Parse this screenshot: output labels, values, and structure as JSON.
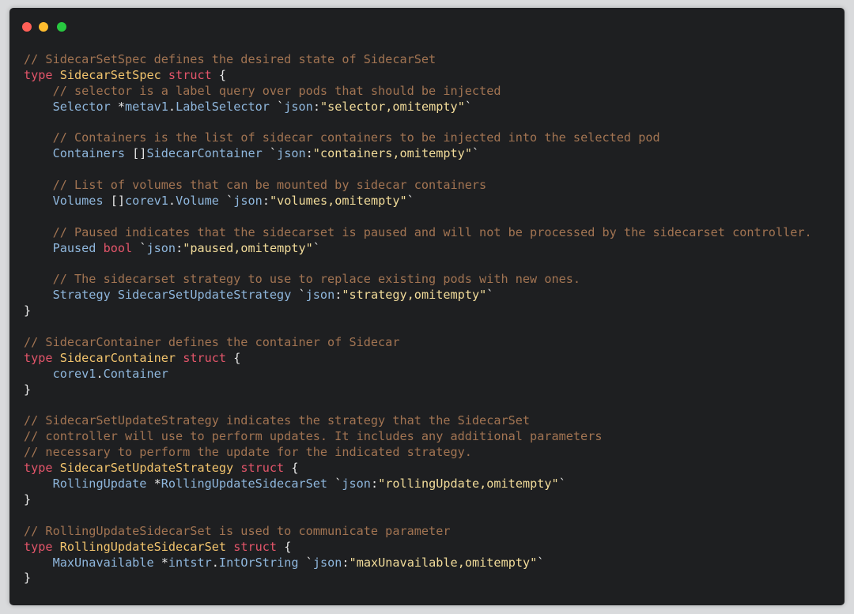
{
  "window": {
    "controls": {
      "close_color": "#ff5f57",
      "minimize_color": "#febc2e",
      "maximize_color": "#28c840"
    }
  },
  "colors": {
    "background": "#1e1f21",
    "comment": "#a27452",
    "keyword": "#e3556a",
    "type_name": "#f2c46d",
    "field": "#8fb7dd",
    "string": "#f2dc9a"
  },
  "code_lines": [
    [
      [
        "// SidecarSetSpec defines the desired state of SidecarSet",
        "comment"
      ]
    ],
    [
      [
        "type",
        "keyword"
      ],
      [
        " ",
        "plain"
      ],
      [
        "SidecarSetSpec",
        "typename"
      ],
      [
        " ",
        "plain"
      ],
      [
        "struct",
        "keyword"
      ],
      [
        " {",
        "plain"
      ]
    ],
    [
      [
        "    ",
        "plain"
      ],
      [
        "// selector is a label query over pods that should be injected",
        "comment"
      ]
    ],
    [
      [
        "    ",
        "plain"
      ],
      [
        "Selector",
        "field"
      ],
      [
        " *",
        "plain"
      ],
      [
        "metav1",
        "type"
      ],
      [
        ".",
        "plain"
      ],
      [
        "LabelSelector",
        "type"
      ],
      [
        " `",
        "plain"
      ],
      [
        "json",
        "tag"
      ],
      [
        ":",
        "plain"
      ],
      [
        "\"selector,omitempty\"",
        "string"
      ],
      [
        "`",
        "plain"
      ]
    ],
    [],
    [
      [
        "    ",
        "plain"
      ],
      [
        "// Containers is the list of sidecar containers to be injected into the selected pod",
        "comment"
      ]
    ],
    [
      [
        "    ",
        "plain"
      ],
      [
        "Containers",
        "field"
      ],
      [
        " []",
        "plain"
      ],
      [
        "SidecarContainer",
        "type"
      ],
      [
        " `",
        "plain"
      ],
      [
        "json",
        "tag"
      ],
      [
        ":",
        "plain"
      ],
      [
        "\"containers,omitempty\"",
        "string"
      ],
      [
        "`",
        "plain"
      ]
    ],
    [],
    [
      [
        "    ",
        "plain"
      ],
      [
        "// List of volumes that can be mounted by sidecar containers",
        "comment"
      ]
    ],
    [
      [
        "    ",
        "plain"
      ],
      [
        "Volumes",
        "field"
      ],
      [
        " []",
        "plain"
      ],
      [
        "corev1",
        "type"
      ],
      [
        ".",
        "plain"
      ],
      [
        "Volume",
        "type"
      ],
      [
        " `",
        "plain"
      ],
      [
        "json",
        "tag"
      ],
      [
        ":",
        "plain"
      ],
      [
        "\"volumes,omitempty\"",
        "string"
      ],
      [
        "`",
        "plain"
      ]
    ],
    [],
    [
      [
        "    ",
        "plain"
      ],
      [
        "// Paused indicates that the sidecarset is paused and will not be processed by the sidecarset controller.",
        "comment"
      ]
    ],
    [
      [
        "    ",
        "plain"
      ],
      [
        "Paused",
        "field"
      ],
      [
        " ",
        "plain"
      ],
      [
        "bool",
        "keyword"
      ],
      [
        " `",
        "plain"
      ],
      [
        "json",
        "tag"
      ],
      [
        ":",
        "plain"
      ],
      [
        "\"paused,omitempty\"",
        "string"
      ],
      [
        "`",
        "plain"
      ]
    ],
    [],
    [
      [
        "    ",
        "plain"
      ],
      [
        "// The sidecarset strategy to use to replace existing pods with new ones.",
        "comment"
      ]
    ],
    [
      [
        "    ",
        "plain"
      ],
      [
        "Strategy",
        "field"
      ],
      [
        " ",
        "plain"
      ],
      [
        "SidecarSetUpdateStrategy",
        "type"
      ],
      [
        " `",
        "plain"
      ],
      [
        "json",
        "tag"
      ],
      [
        ":",
        "plain"
      ],
      [
        "\"strategy,omitempty\"",
        "string"
      ],
      [
        "`",
        "plain"
      ]
    ],
    [
      [
        "}",
        "plain"
      ]
    ],
    [],
    [
      [
        "// SidecarContainer defines the container of Sidecar",
        "comment"
      ]
    ],
    [
      [
        "type",
        "keyword"
      ],
      [
        " ",
        "plain"
      ],
      [
        "SidecarContainer",
        "typename"
      ],
      [
        " ",
        "plain"
      ],
      [
        "struct",
        "keyword"
      ],
      [
        " {",
        "plain"
      ]
    ],
    [
      [
        "    ",
        "plain"
      ],
      [
        "corev1",
        "type"
      ],
      [
        ".",
        "plain"
      ],
      [
        "Container",
        "type"
      ]
    ],
    [
      [
        "}",
        "plain"
      ]
    ],
    [],
    [
      [
        "// SidecarSetUpdateStrategy indicates the strategy that the SidecarSet",
        "comment"
      ]
    ],
    [
      [
        "// controller will use to perform updates. It includes any additional parameters",
        "comment"
      ]
    ],
    [
      [
        "// necessary to perform the update for the indicated strategy.",
        "comment"
      ]
    ],
    [
      [
        "type",
        "keyword"
      ],
      [
        " ",
        "plain"
      ],
      [
        "SidecarSetUpdateStrategy",
        "typename"
      ],
      [
        " ",
        "plain"
      ],
      [
        "struct",
        "keyword"
      ],
      [
        " {",
        "plain"
      ]
    ],
    [
      [
        "    ",
        "plain"
      ],
      [
        "RollingUpdate",
        "field"
      ],
      [
        " *",
        "plain"
      ],
      [
        "RollingUpdateSidecarSet",
        "type"
      ],
      [
        " `",
        "plain"
      ],
      [
        "json",
        "tag"
      ],
      [
        ":",
        "plain"
      ],
      [
        "\"rollingUpdate,omitempty\"",
        "string"
      ],
      [
        "`",
        "plain"
      ]
    ],
    [
      [
        "}",
        "plain"
      ]
    ],
    [],
    [
      [
        "// RollingUpdateSidecarSet is used to communicate parameter",
        "comment"
      ]
    ],
    [
      [
        "type",
        "keyword"
      ],
      [
        " ",
        "plain"
      ],
      [
        "RollingUpdateSidecarSet",
        "typename"
      ],
      [
        " ",
        "plain"
      ],
      [
        "struct",
        "keyword"
      ],
      [
        " {",
        "plain"
      ]
    ],
    [
      [
        "    ",
        "plain"
      ],
      [
        "MaxUnavailable",
        "field"
      ],
      [
        " *",
        "plain"
      ],
      [
        "intstr",
        "type"
      ],
      [
        ".",
        "plain"
      ],
      [
        "IntOrString",
        "type"
      ],
      [
        " `",
        "plain"
      ],
      [
        "json",
        "tag"
      ],
      [
        ":",
        "plain"
      ],
      [
        "\"maxUnavailable,omitempty\"",
        "string"
      ],
      [
        "`",
        "plain"
      ]
    ],
    [
      [
        "}",
        "plain"
      ]
    ]
  ]
}
